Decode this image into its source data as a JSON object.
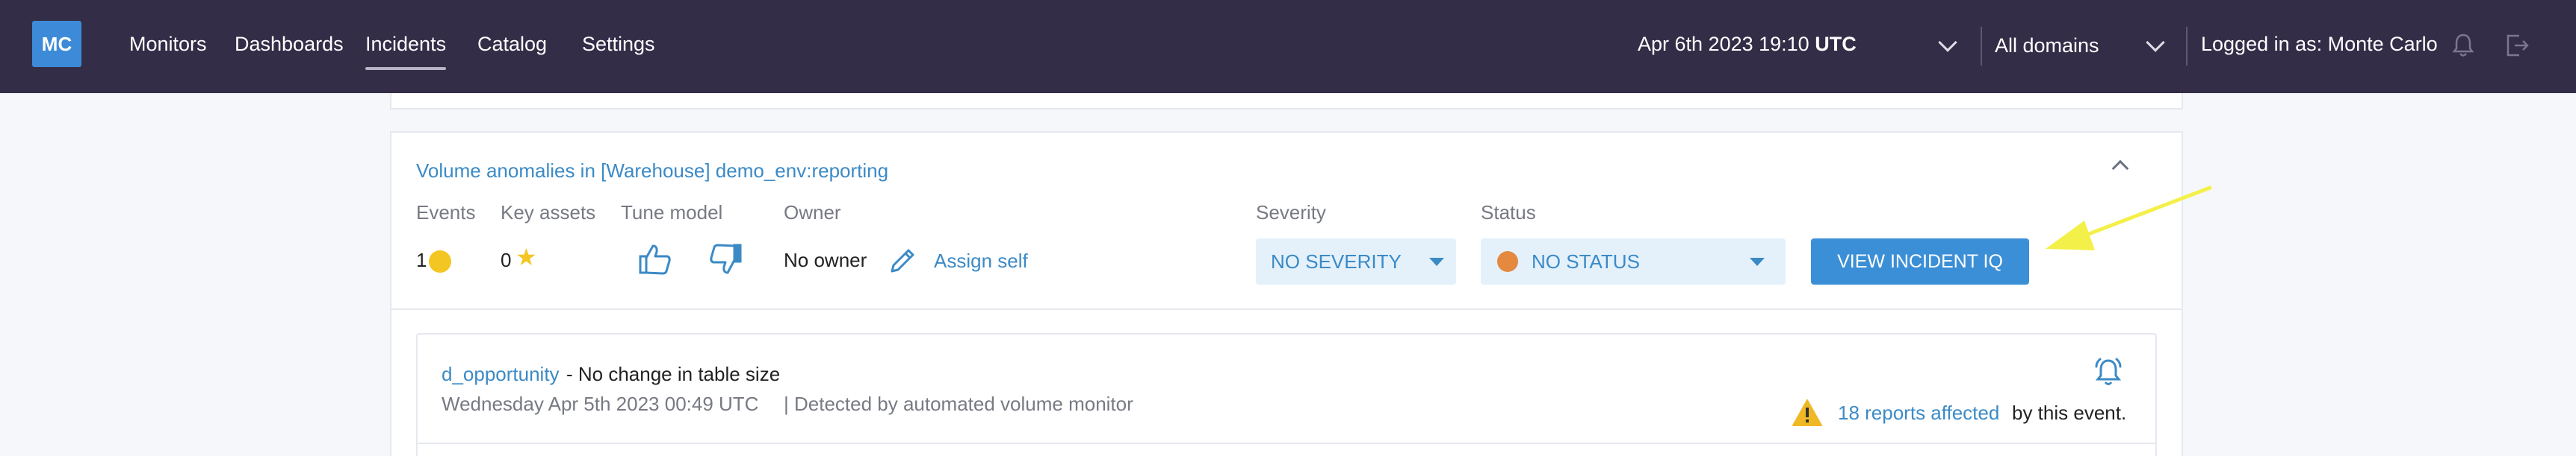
{
  "nav": {
    "logo": "MC",
    "items": [
      "Monitors",
      "Dashboards",
      "Incidents",
      "Catalog",
      "Settings"
    ],
    "active": "Incidents",
    "date": "Apr 6th 2023 19:10",
    "timezone": "UTC",
    "domains": "All domains",
    "logged_in": "Logged in as: Monte Carlo"
  },
  "incident": {
    "title": "Volume anomalies in [Warehouse] demo_env:reporting",
    "labels": {
      "events": "Events",
      "key_assets": "Key assets",
      "tune_model": "Tune model",
      "owner": "Owner",
      "severity": "Severity",
      "status": "Status"
    },
    "events_count": "1",
    "key_assets_count": "0",
    "owner": "No owner",
    "assign": "Assign self",
    "severity": "NO SEVERITY",
    "status": "NO STATUS",
    "view_button": "VIEW INCIDENT IQ"
  },
  "event": {
    "table": "d_opportunity",
    "description": "- No change in table size",
    "date": "Wednesday Apr 5th 2023 00:49 UTC",
    "detected": "| Detected by automated volume monitor",
    "reports_link": "18 reports affected",
    "reports_suffix": "by this event."
  },
  "colors": {
    "nav_bg": "#342d47",
    "accent": "#3b8ac6",
    "button": "#3b8fd6",
    "status_dot": "#e4893f",
    "event_dot": "#f3c623",
    "annotation_arrow": "#f4f04a"
  }
}
